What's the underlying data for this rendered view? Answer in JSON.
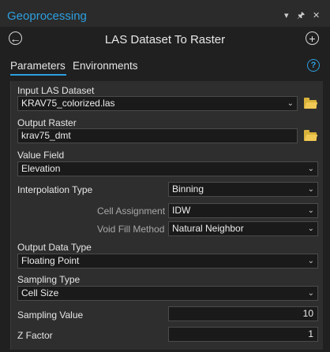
{
  "pane": {
    "title": "Geoprocessing",
    "options_icon": "chevron-down-icon",
    "pin_icon": "pin-icon",
    "close_icon": "close-icon",
    "options_glyph": "▾",
    "pin_glyph": "🖈",
    "close_glyph": "✕"
  },
  "tool": {
    "title": "LAS Dataset To Raster",
    "back_glyph": "←",
    "add_glyph": "+"
  },
  "tabs": [
    {
      "label": "Parameters",
      "active": true
    },
    {
      "label": "Environments",
      "active": false
    }
  ],
  "help_glyph": "?",
  "params": {
    "input_las": {
      "label": "Input LAS Dataset",
      "value": "KRAV75_colorized.las"
    },
    "output_raster": {
      "label": "Output Raster",
      "value": "krav75_dmt"
    },
    "value_field": {
      "label": "Value Field",
      "value": "Elevation"
    },
    "interpolation_type": {
      "label": "Interpolation Type",
      "value": "Binning"
    },
    "cell_assignment": {
      "label": "Cell Assignment",
      "value": "IDW"
    },
    "void_fill": {
      "label": "Void Fill Method",
      "value": "Natural Neighbor"
    },
    "output_data_type": {
      "label": "Output Data Type",
      "value": "Floating Point"
    },
    "sampling_type": {
      "label": "Sampling Type",
      "value": "Cell Size"
    },
    "sampling_value": {
      "label": "Sampling Value",
      "value": "10"
    },
    "z_factor": {
      "label": "Z Factor",
      "value": "1"
    }
  },
  "dropdown_glyph": "⌄",
  "colors": {
    "accent": "#2c9fe0",
    "folder": "#d9b23b"
  }
}
